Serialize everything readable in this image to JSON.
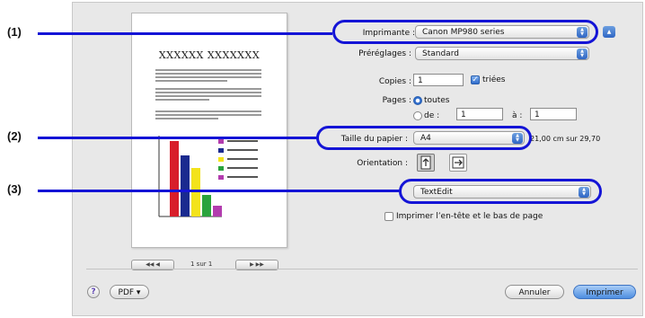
{
  "callouts": [
    {
      "label": "(1)"
    },
    {
      "label": "(2)"
    },
    {
      "label": "(3)"
    }
  ],
  "preview": {
    "title": "XXXXXX XXXXXXX",
    "pager_text": "1 sur 1",
    "first_prev": "◀◀ ◀",
    "next_last": "▶ ▶▶",
    "bar_colors": [
      "#d81e2a",
      "#1a2a8f",
      "#f3e31b",
      "#2aa33c",
      "#b23cae"
    ]
  },
  "form": {
    "printer_label": "Imprimante :",
    "printer_value": "Canon MP980 series",
    "presets_label": "Préréglages :",
    "presets_value": "Standard",
    "copies_label": "Copies :",
    "copies_value": "1",
    "collated_label": "triées",
    "pages_label": "Pages :",
    "pages_all": "toutes",
    "pages_from": "de :",
    "pages_from_value": "1",
    "pages_to": "à :",
    "pages_to_value": "1",
    "paper_label": "Taille du papier :",
    "paper_value": "A4",
    "paper_size_text": "21,00 cm sur 29,70",
    "orientation_label": "Orientation :",
    "app_popup_value": "TextEdit",
    "header_footer_label": "Imprimer l’en-tête et le bas de page"
  },
  "footer": {
    "help": "?",
    "pdf_button": "PDF ▾",
    "cancel_button": "Annuler",
    "print_button": "Imprimer"
  }
}
